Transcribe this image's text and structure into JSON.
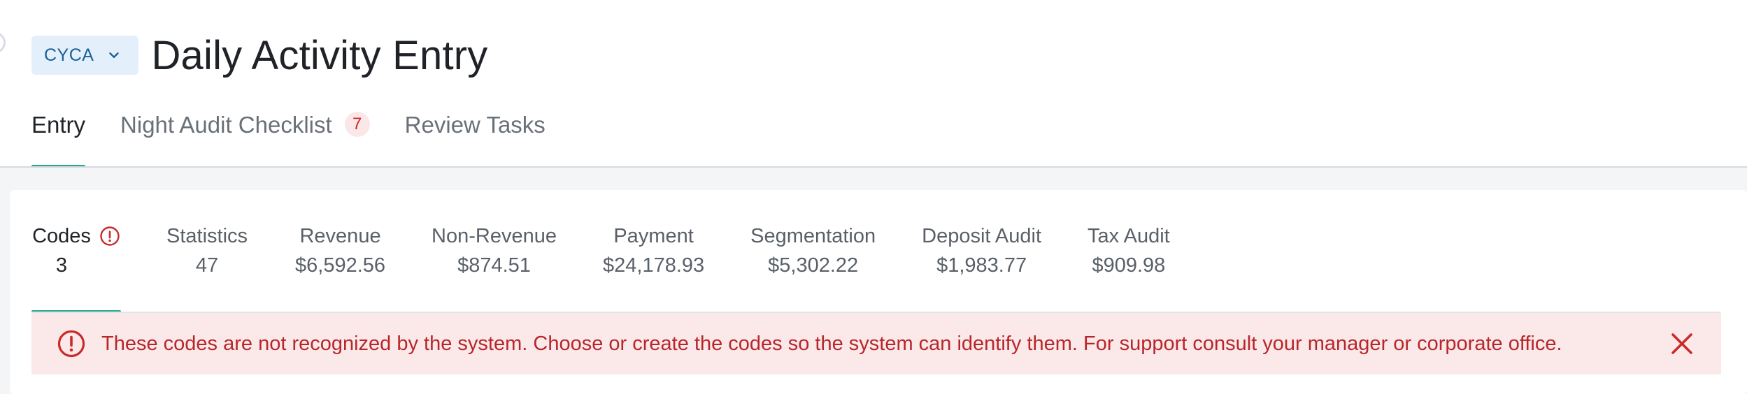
{
  "header": {
    "property_code": "CYCA",
    "title": "Daily Activity Entry"
  },
  "tabs": [
    {
      "label": "Entry",
      "active": true
    },
    {
      "label": "Night Audit Checklist",
      "badge": "7"
    },
    {
      "label": "Review Tasks"
    }
  ],
  "summary": [
    {
      "label": "Codes",
      "value": "3",
      "active": true,
      "warning": true
    },
    {
      "label": "Statistics",
      "value": "47"
    },
    {
      "label": "Revenue",
      "value": "$6,592.56"
    },
    {
      "label": "Non-Revenue",
      "value": "$874.51"
    },
    {
      "label": "Payment",
      "value": "$24,178.93"
    },
    {
      "label": "Segmentation",
      "value": "$5,302.22"
    },
    {
      "label": "Deposit Audit",
      "value": "$1,983.77"
    },
    {
      "label": "Tax Audit",
      "value": "$909.98"
    }
  ],
  "alert": {
    "message": "These codes are not recognized by the system. Choose or create the codes so the system can identify them. For support consult your manager or corporate office."
  },
  "colors": {
    "accent": "#2aa58f",
    "error": "#c92a2a",
    "error_bg": "#fbe9e9",
    "selector_bg": "#e3f0fb"
  },
  "icons": {
    "selector_chevron": "chevron-down-icon",
    "codes_warning": "alert-circle-icon",
    "alert": "alert-circle-icon",
    "close": "close-icon"
  }
}
